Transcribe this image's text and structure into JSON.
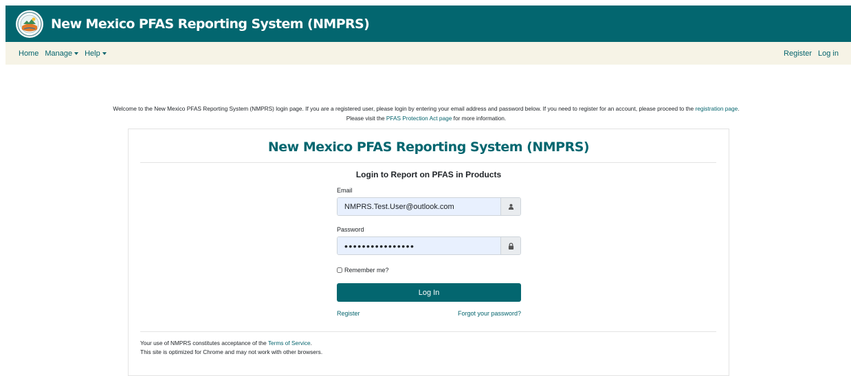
{
  "header": {
    "title": "New Mexico PFAS Reporting System (NMPRS)",
    "logo_icon": "new-mexico-seal-icon",
    "brand_color": "#03666f"
  },
  "nav": {
    "home": "Home",
    "manage": "Manage",
    "help": "Help",
    "register": "Register",
    "login": "Log in"
  },
  "welcome": {
    "text_1": "Welcome to the New Mexico PFAS Reporting System (NMPRS) login page. If you are a registered user, please login by entering your email address and password below. If you need to register for an account, please proceed to the ",
    "registration_link": "registration page",
    "text_2": ". Please visit the ",
    "act_link": "PFAS Protection Act page",
    "text_3": " for more information."
  },
  "card": {
    "title": "New Mexico PFAS Reporting System (NMPRS)",
    "subtitle": "Login to Report on PFAS in Products",
    "email_label": "Email",
    "email_value": "NMPRS.Test.User@outlook.com",
    "email_icon": "user-icon",
    "password_label": "Password",
    "password_value": "••••••••••••••••",
    "password_icon": "lock-icon",
    "remember_label": "Remember me?",
    "login_button": "Log In",
    "register_link": "Register",
    "forgot_link": "Forgot your password?"
  },
  "footer": {
    "line1_prefix": "Your use of NMPRS constitutes acceptance of the ",
    "terms_link": "Terms of Service",
    "line1_suffix": ".",
    "line2": "This site is optimized for Chrome and may not work with other browsers."
  }
}
